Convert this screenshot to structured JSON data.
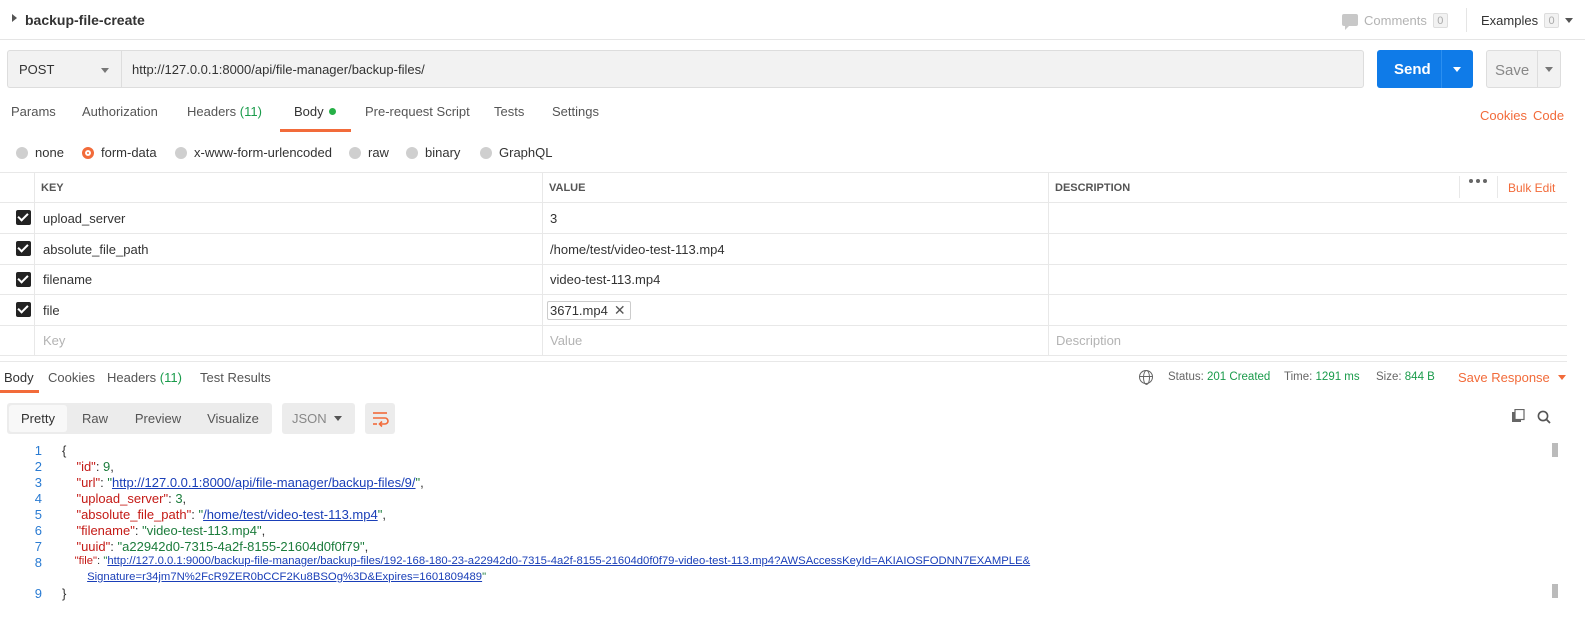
{
  "request_name": "backup-file-create",
  "top": {
    "comments_label": "Comments",
    "comments_count": "0",
    "examples_label": "Examples",
    "examples_count": "0"
  },
  "url_bar": {
    "method": "POST",
    "url": "http://127.0.0.1:8000/api/file-manager/backup-files/",
    "send_label": "Send",
    "save_label": "Save"
  },
  "request_tabs": {
    "params": "Params",
    "authorization": "Authorization",
    "headers": "Headers",
    "headers_count": "(11)",
    "body": "Body",
    "prerequest": "Pre-request Script",
    "tests": "Tests",
    "settings": "Settings",
    "cookies": "Cookies",
    "code": "Code"
  },
  "body_types": {
    "none": "none",
    "form_data": "form-data",
    "urlencoded": "x-www-form-urlencoded",
    "raw": "raw",
    "binary": "binary",
    "graphql": "GraphQL"
  },
  "params_table": {
    "headers": {
      "key": "KEY",
      "value": "VALUE",
      "description": "DESCRIPTION",
      "bulk_edit": "Bulk Edit"
    },
    "rows": [
      {
        "key": "upload_server",
        "value": "3"
      },
      {
        "key": "absolute_file_path",
        "value": "/home/test/video-test-113.mp4"
      },
      {
        "key": "filename",
        "value": "video-test-113.mp4"
      },
      {
        "key": "file",
        "value": "3671.mp4"
      }
    ],
    "placeholders": {
      "key": "Key",
      "value": "Value",
      "description": "Description"
    }
  },
  "response": {
    "tabs": {
      "body": "Body",
      "cookies": "Cookies",
      "headers": "Headers",
      "headers_count": "(11)",
      "test_results": "Test Results"
    },
    "status_label": "Status:",
    "status_value": "201 Created",
    "time_label": "Time:",
    "time_value": "1291 ms",
    "size_label": "Size:",
    "size_value": "844 B",
    "save_response": "Save Response",
    "views": {
      "pretty": "Pretty",
      "raw": "Raw",
      "preview": "Preview",
      "visualize": "Visualize"
    },
    "format": "JSON",
    "json": {
      "id": "9",
      "url": "http://127.0.0.1:8000/api/file-manager/backup-files/9/",
      "upload_server": "3",
      "absolute_file_path": "/home/test/video-test-113.mp4",
      "filename": "video-test-113.mp4",
      "uuid": "a22942d0-7315-4a2f-8155-21604d0f0f79",
      "file_line1": "http://127.0.0.1:9000/backup-file-manager/backup-files/192-168-180-23-a22942d0-7315-4a2f-8155-21604d0f0f79-video-test-113.mp4?AWSAccessKeyId=AKIAIOSFODNN7EXAMPLE&",
      "file_line2": "Signature=r34jm7N%2FcR9ZER0bCCF2Ku8BSOg%3D&Expires=1601809489"
    }
  },
  "colors": {
    "accent": "#f26b3a",
    "send": "#0f7be8",
    "success": "#1a9b4b"
  }
}
